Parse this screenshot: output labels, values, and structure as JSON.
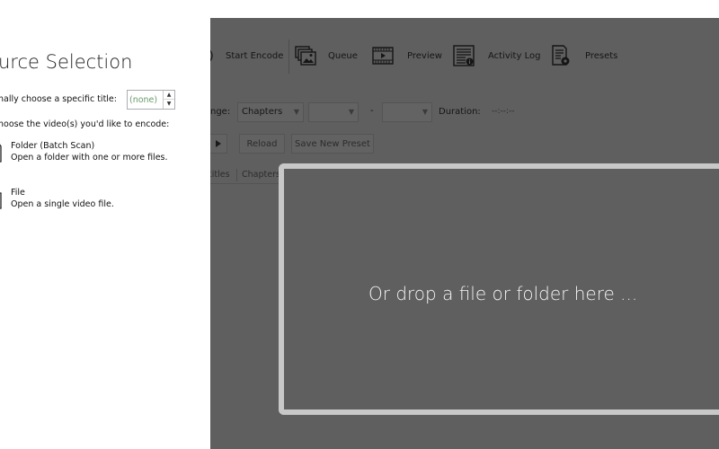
{
  "panel": {
    "title": "urce Selection",
    "specific_title_label": "nally choose a specific title:",
    "specific_title_value": "(none)",
    "choose_label": "hoose the video(s) you'd like to encode:",
    "options": [
      {
        "name": "Folder (Batch Scan)",
        "desc": "Open a folder with one or more files."
      },
      {
        "name": "File",
        "desc": "Open a single video file."
      }
    ]
  },
  "toolbar": {
    "start_encode": "Start Encode",
    "queue": "Queue",
    "preview": "Preview",
    "activity_log": "Activity Log",
    "presets": "Presets"
  },
  "range": {
    "label": "nge:",
    "mode": "Chapters",
    "dash": "-",
    "duration_label": "Duration:",
    "duration_value": "--:--:--"
  },
  "buttons": {
    "reload": "Reload",
    "save_new_preset": "Save New Preset"
  },
  "tabs": [
    "titles",
    "Chapters"
  ],
  "dropzone": {
    "text": "Or drop a file or folder here ..."
  },
  "colors": {
    "overlay": "#5f5f5f",
    "drop_border": "#c8c8c8",
    "drop_text": "#f4f4f4"
  }
}
